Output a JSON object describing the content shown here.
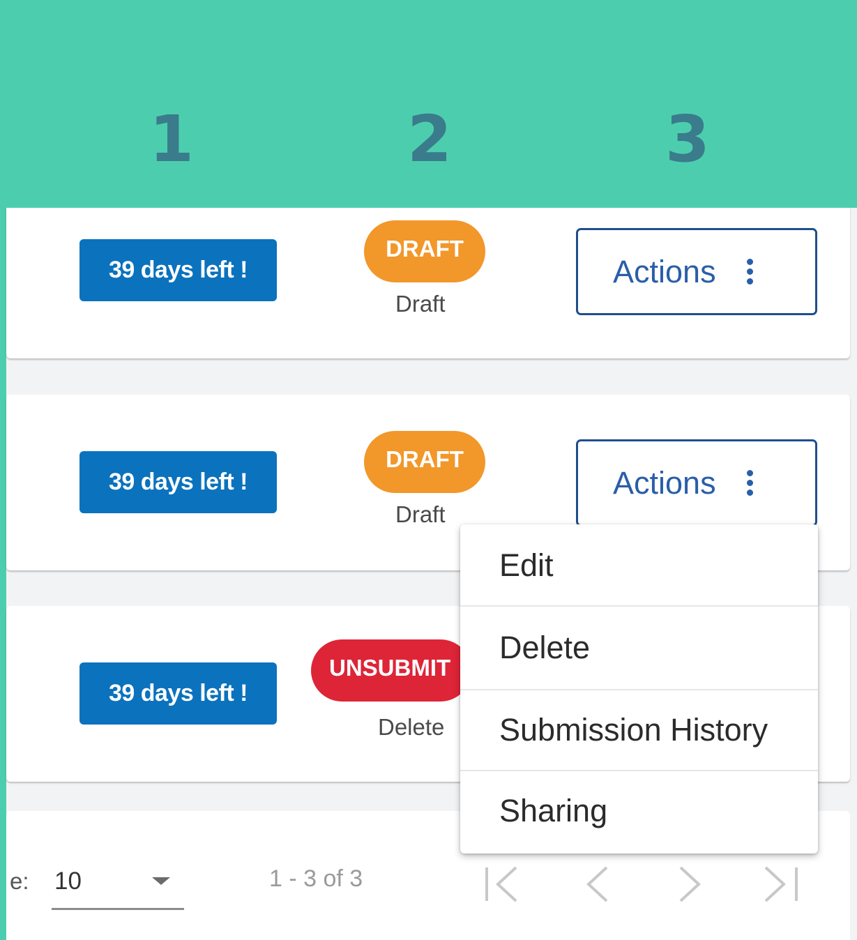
{
  "header": {
    "column_numbers": [
      "1",
      "2",
      "3"
    ]
  },
  "rows": [
    {
      "deadline": "39 days left !",
      "status_badge": "DRAFT",
      "status_text": "Draft",
      "action_label": "Actions"
    },
    {
      "deadline": "39 days left !",
      "status_badge": "DRAFT",
      "status_text": "Draft",
      "action_label": "Actions"
    },
    {
      "deadline": "39 days left !",
      "status_badge": "UNSUBMIT",
      "status_text": "Delete"
    }
  ],
  "actions_menu": {
    "items": [
      "Edit",
      "Delete",
      "Submission History",
      "Sharing"
    ]
  },
  "pagination": {
    "page_size_label": "e:",
    "page_size_value": "10",
    "range": "1 - 3 of 3"
  },
  "colors": {
    "header": "#4cceae",
    "column_number": "#3a7b8c",
    "deadline_badge": "#0b72bd",
    "draft": "#f2972a",
    "unsubmitted": "#dd2537",
    "action_border": "#1f4e8c"
  },
  "icons": {
    "actions": "more-vertical-icon",
    "pager": [
      "first-page-icon",
      "previous-page-icon",
      "next-page-icon",
      "last-page-icon"
    ]
  }
}
